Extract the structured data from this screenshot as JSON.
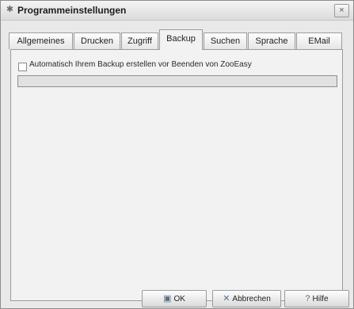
{
  "window": {
    "title": "Programmeinstellungen",
    "close_glyph": "×",
    "title_icon": "gear-icon"
  },
  "tabs": [
    {
      "label": "Allgemeines",
      "active": false
    },
    {
      "label": "Drucken",
      "active": false
    },
    {
      "label": "Zugriff",
      "active": false
    },
    {
      "label": "Backup",
      "active": true
    },
    {
      "label": "Suchen",
      "active": false
    },
    {
      "label": "Sprache",
      "active": false
    },
    {
      "label": "EMail",
      "active": false
    }
  ],
  "backup": {
    "auto_backup_label": "Automatisch Ihrem Backup erstellen vor Beenden von ZooEasy",
    "auto_backup_checked": false,
    "path_value": ""
  },
  "buttons": {
    "ok": {
      "label": "OK",
      "icon": "save-icon"
    },
    "cancel": {
      "label": "Abbrechen",
      "icon": "cancel-icon"
    },
    "help": {
      "label": "Hilfe",
      "icon": "help-icon"
    }
  },
  "colors": {
    "window_bg": "#e9e9e9",
    "panel_bg": "#f2f2f2",
    "field_bg": "#e1e1e1"
  }
}
